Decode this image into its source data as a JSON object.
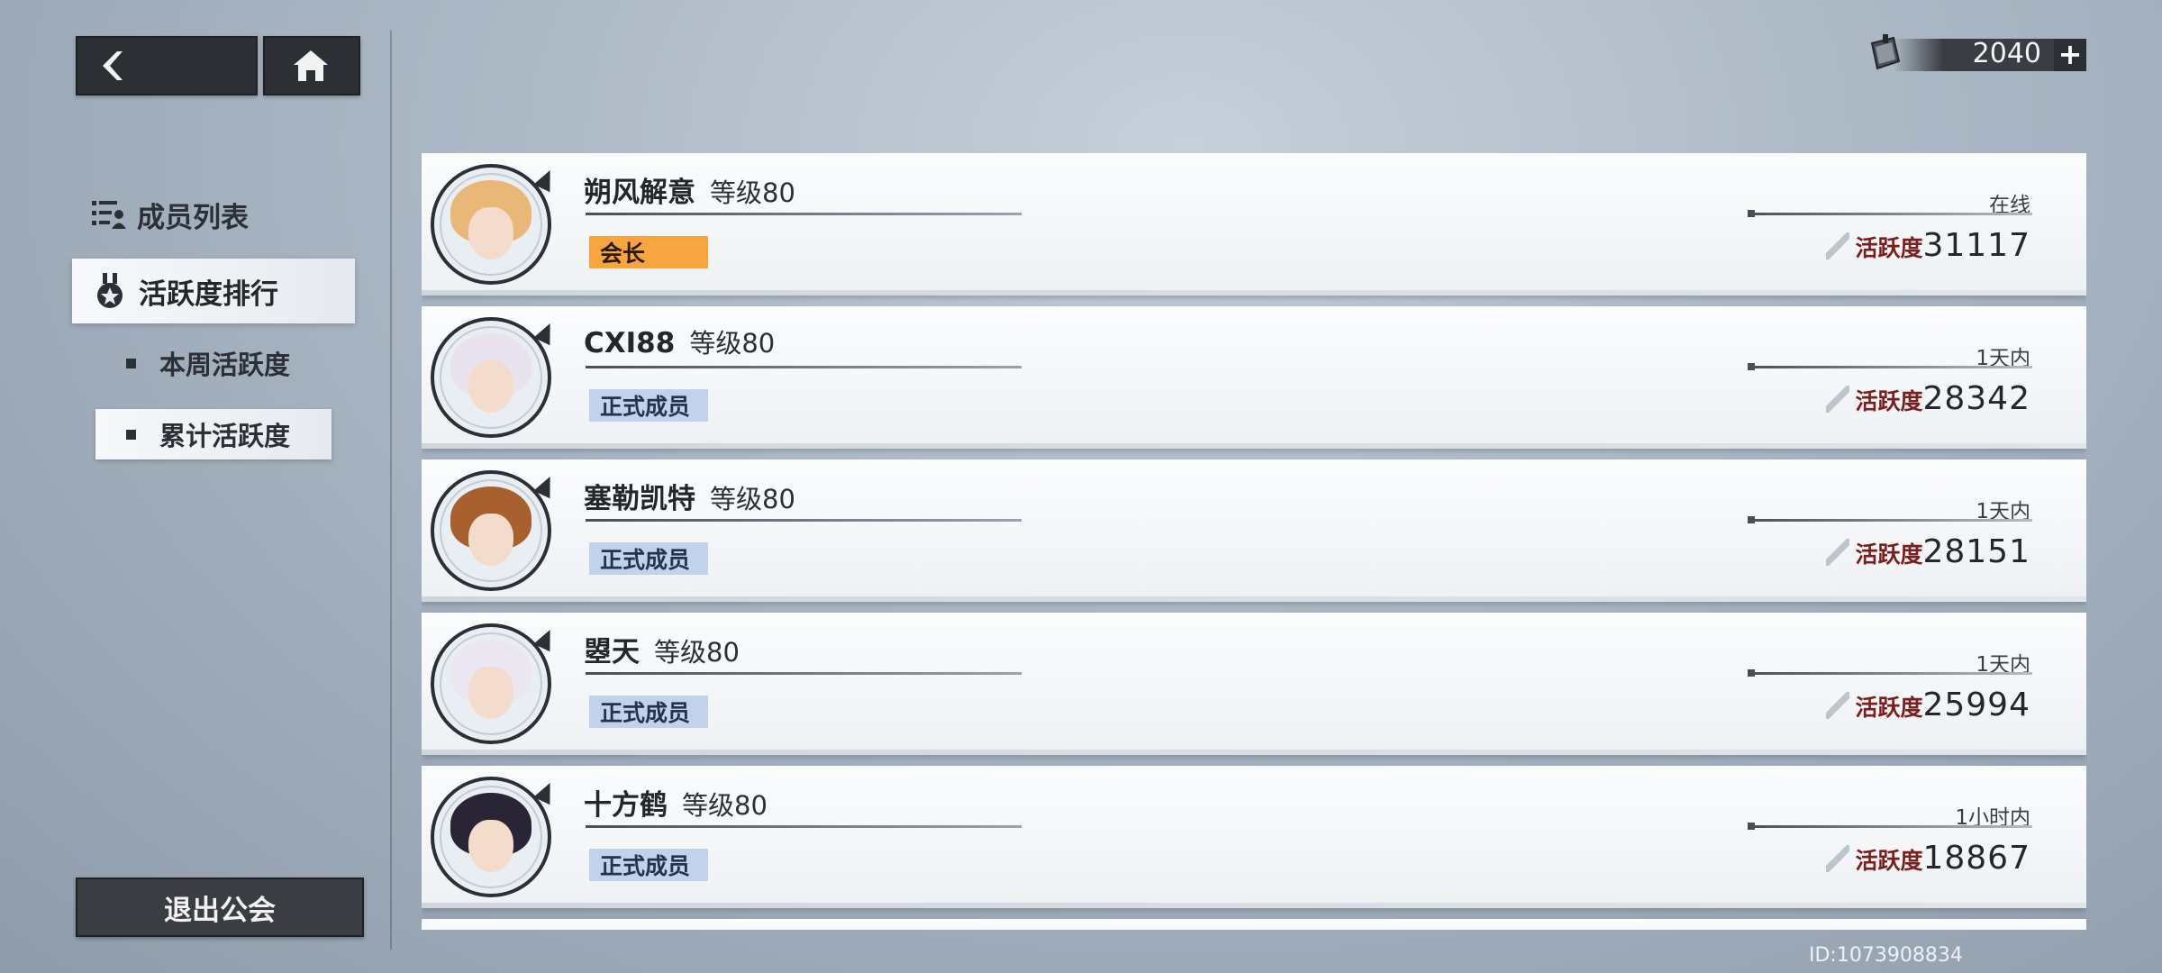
{
  "currency": {
    "value": "2040",
    "add_label": "+",
    "icon": "ticket-icon"
  },
  "sidebar": {
    "member_list_label": "成员列表",
    "activity_rank_label": "活跃度排行",
    "weekly_label": "本周活跃度",
    "total_label": "累计活跃度",
    "quit_label": "退出公会"
  },
  "members": [
    {
      "name": "朔风解意",
      "level": "等级80",
      "role": "会长",
      "status": "在线",
      "activity_label": "活跃度",
      "activity": "31117",
      "hair": "#e9b878"
    },
    {
      "name": "CXI88",
      "level": "等级80",
      "role": "正式成员",
      "status": "1天内",
      "activity_label": "活跃度",
      "activity": "28342",
      "hair": "#e9e3ef"
    },
    {
      "name": "塞勒凯特",
      "level": "等级80",
      "role": "正式成员",
      "status": "1天内",
      "activity_label": "活跃度",
      "activity": "28151",
      "hair": "#a8612e"
    },
    {
      "name": "曌天",
      "level": "等级80",
      "role": "正式成员",
      "status": "1天内",
      "activity_label": "活跃度",
      "activity": "25994",
      "hair": "#ece6f1"
    },
    {
      "name": "十方鹤",
      "level": "等级80",
      "role": "正式成员",
      "status": "1小时内",
      "activity_label": "活跃度",
      "activity": "18867",
      "hair": "#2a2437"
    }
  ],
  "footer": {
    "uid": "ID:1073908834"
  },
  "colors": {
    "leader_badge": "#f7a441",
    "member_badge": "#c3d2eb",
    "activity_label": "#7a1e1e"
  }
}
